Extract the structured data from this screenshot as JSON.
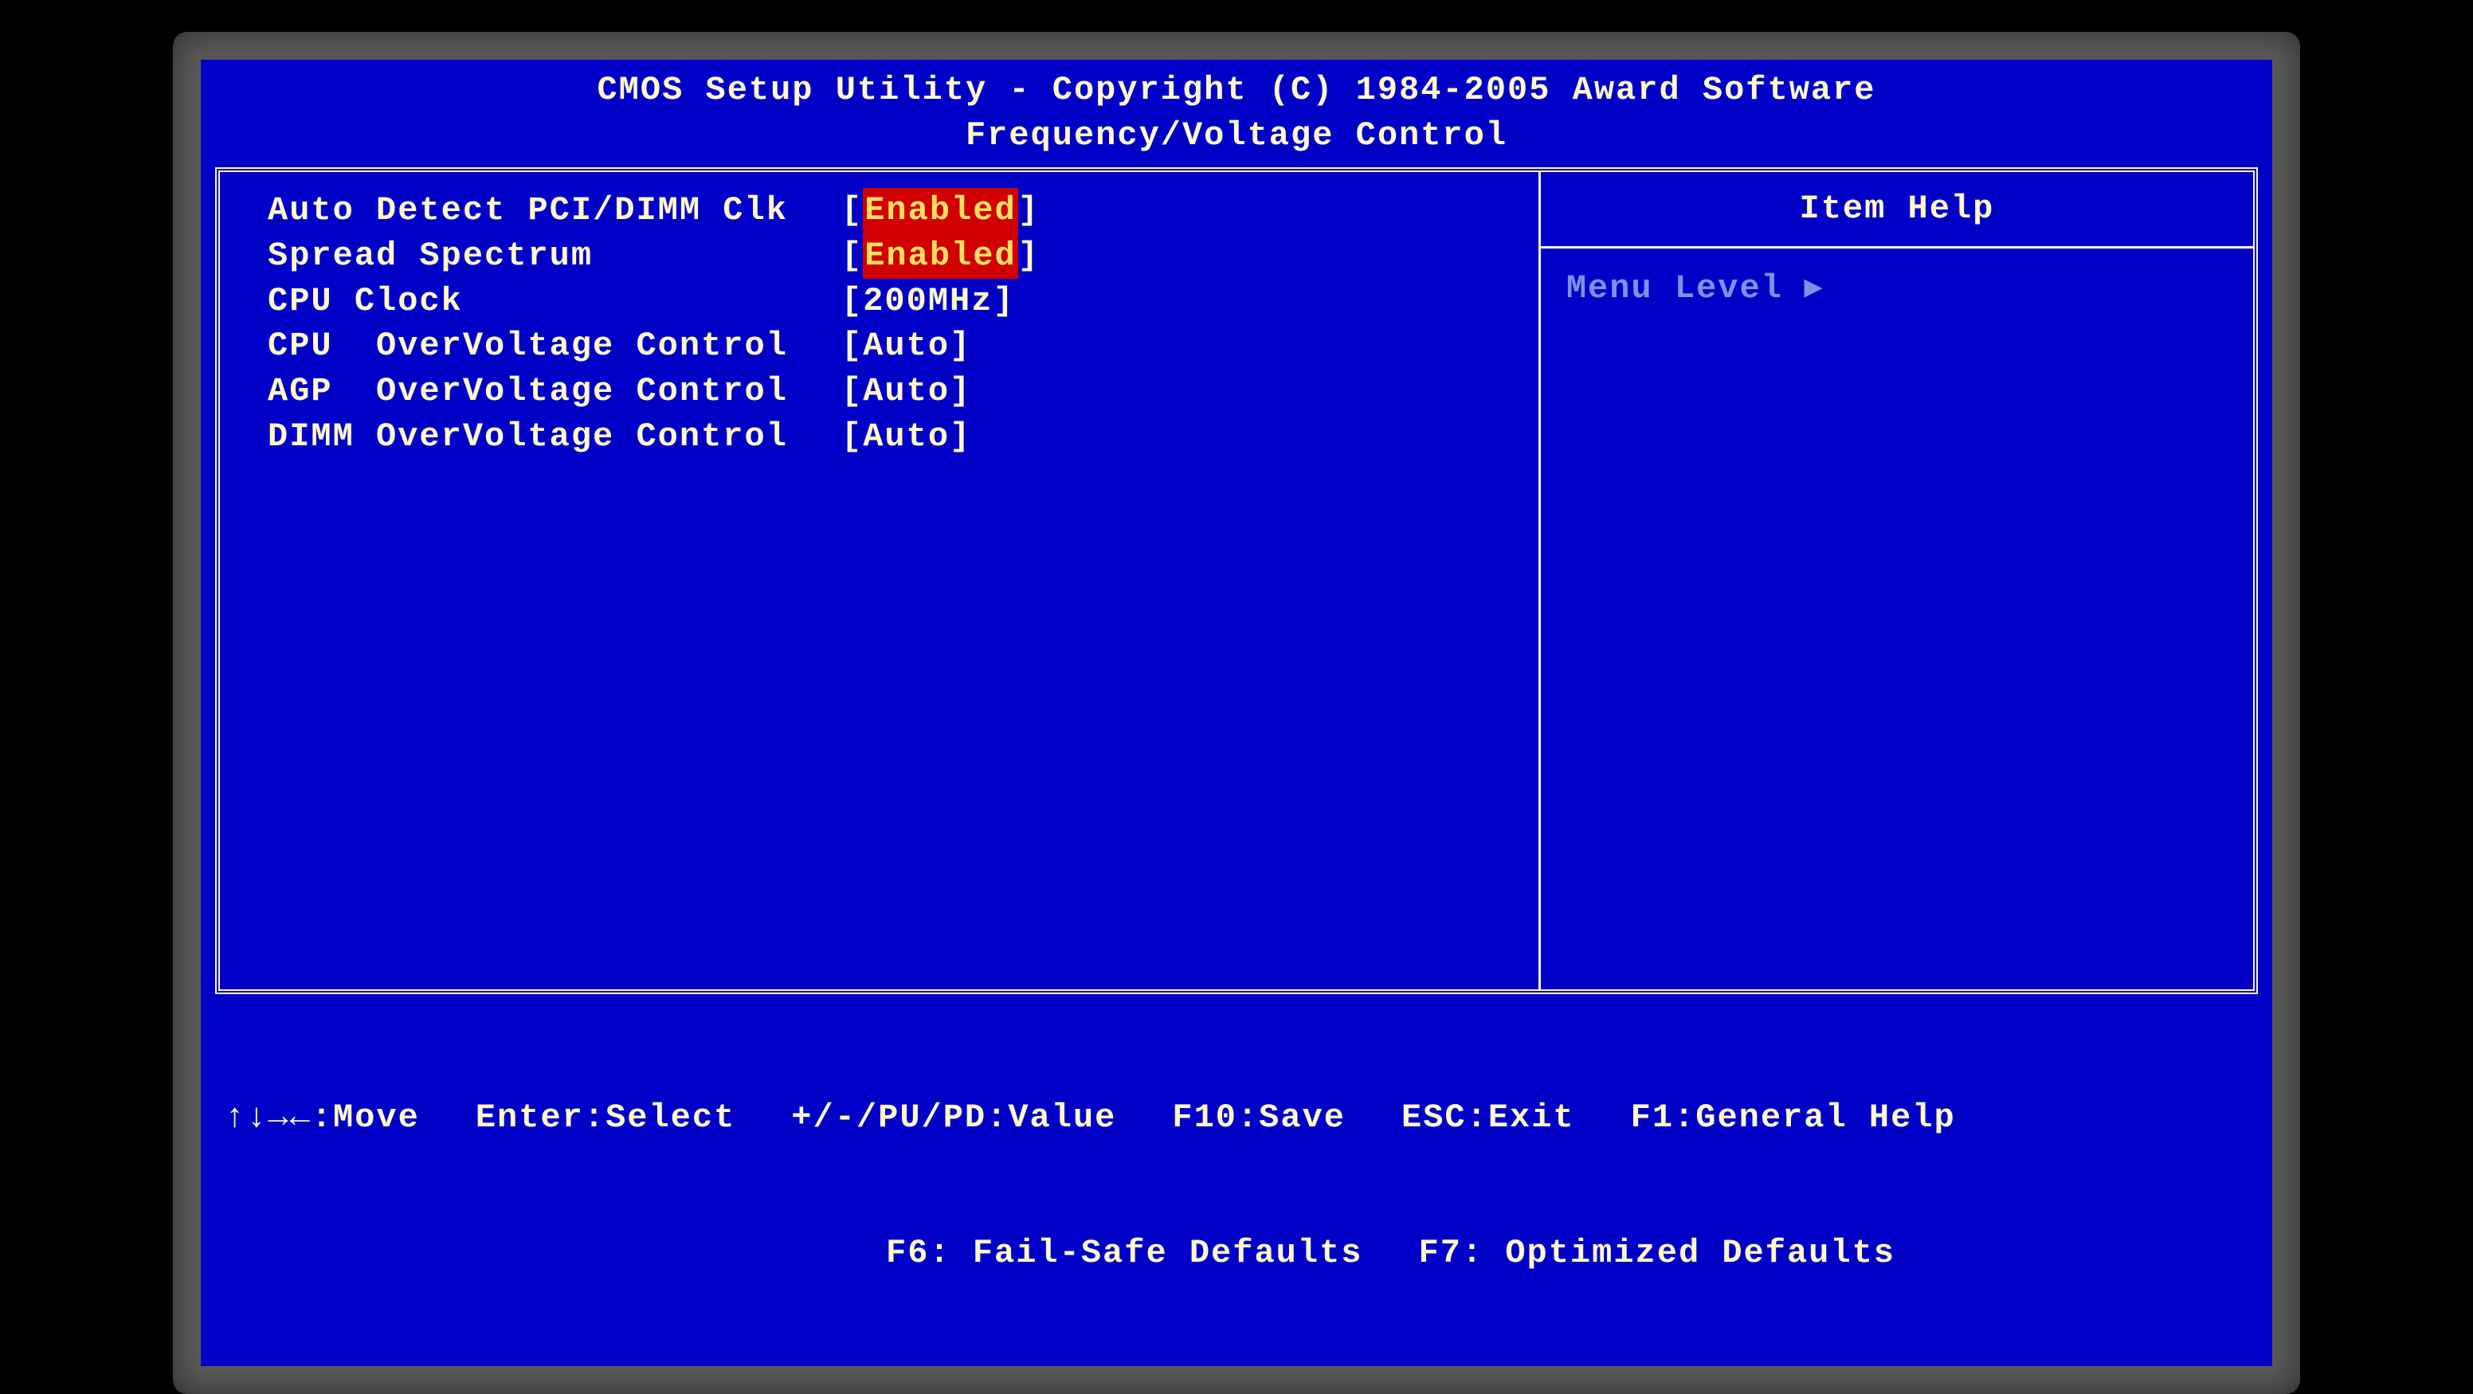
{
  "header": {
    "title": "CMOS Setup Utility - Copyright (C) 1984-2005 Award Software",
    "subtitle": "Frequency/Voltage Control"
  },
  "items": [
    {
      "label": "Auto Detect PCI/DIMM Clk",
      "value": "Enabled",
      "style": "enabled",
      "selected": true
    },
    {
      "label": "Spread Spectrum",
      "value": "Enabled",
      "style": "enabled",
      "selected": false
    },
    {
      "label": "CPU Clock",
      "value": "200MHz",
      "style": "normal",
      "selected": false
    },
    {
      "label": "CPU  OverVoltage Control",
      "value": "Auto",
      "style": "normal",
      "selected": false
    },
    {
      "label": "AGP  OverVoltage Control",
      "value": "Auto",
      "style": "normal",
      "selected": false
    },
    {
      "label": "DIMM OverVoltage Control",
      "value": "Auto",
      "style": "normal",
      "selected": false
    }
  ],
  "help": {
    "title": "Item Help",
    "menu_level_label": "Menu Level",
    "arrow": "▸"
  },
  "footer": {
    "move": "↑↓→←:Move",
    "select": "Enter:Select",
    "value": "+/-/PU/PD:Value",
    "save": "F10:Save",
    "exit": "ESC:Exit",
    "general_help": "F1:General Help",
    "failsafe": "F6: Fail-Safe Defaults",
    "optimized": "F7: Optimized Defaults"
  }
}
